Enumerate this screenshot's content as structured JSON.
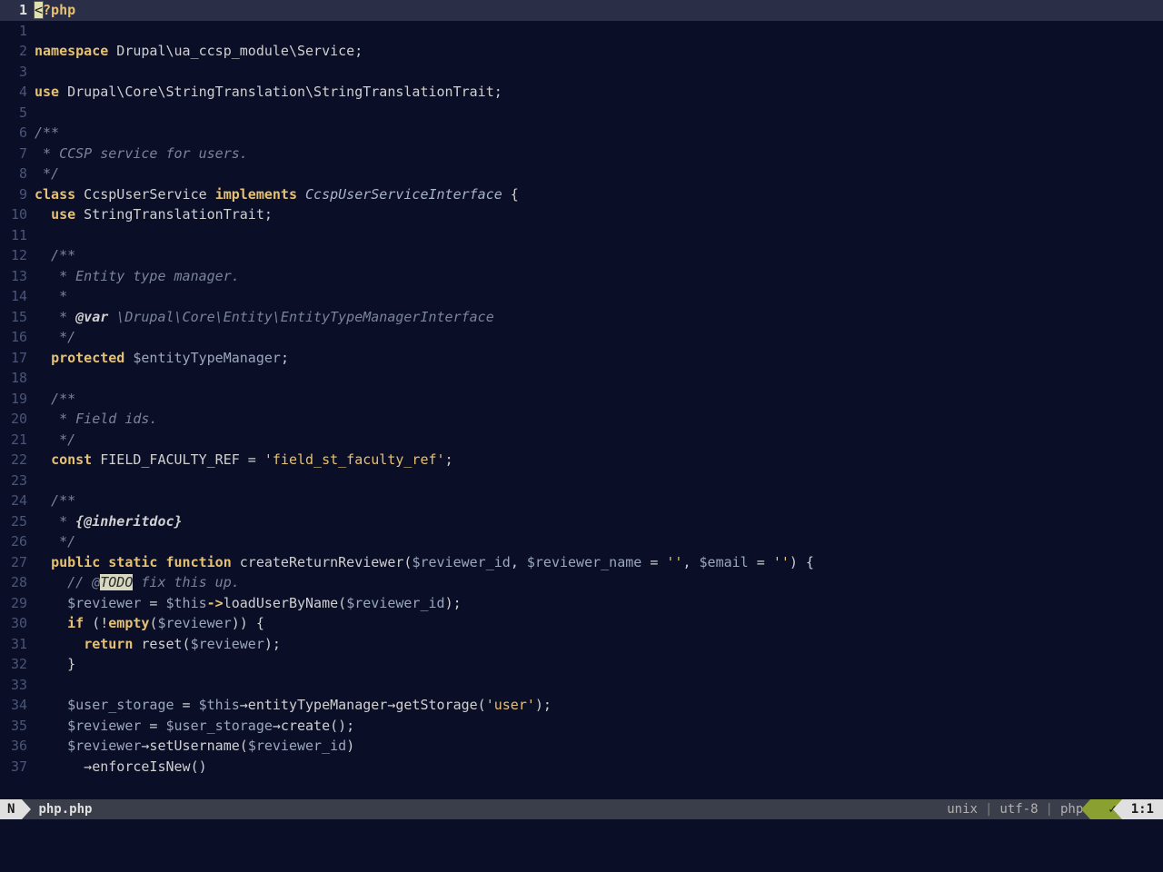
{
  "statusline": {
    "mode": "N",
    "filename": "php.php",
    "fileformat": "unix",
    "encoding": "utf-8",
    "filetype": "php",
    "check": "✓",
    "position": "1:1"
  },
  "cursor": {
    "line": 1,
    "col": 1
  },
  "lines": [
    {
      "n": 1,
      "current": true,
      "tokens": [
        {
          "cls": "cursor",
          "t": "<"
        },
        {
          "cls": "kw",
          "t": "?php"
        }
      ]
    },
    {
      "n": 1,
      "tokens": []
    },
    {
      "n": 2,
      "tokens": [
        {
          "cls": "kw",
          "t": "namespace"
        },
        {
          "cls": "punct",
          "t": " Drupal\\ua_ccsp_module\\Service;"
        }
      ]
    },
    {
      "n": 3,
      "tokens": []
    },
    {
      "n": 4,
      "tokens": [
        {
          "cls": "kw",
          "t": "use"
        },
        {
          "cls": "punct",
          "t": " Drupal\\Core\\StringTranslation\\StringTranslationTrait;"
        }
      ]
    },
    {
      "n": 5,
      "tokens": []
    },
    {
      "n": 6,
      "tokens": [
        {
          "cls": "comment",
          "t": "/**"
        }
      ]
    },
    {
      "n": 7,
      "tokens": [
        {
          "cls": "comment",
          "t": " * CCSP service for users."
        }
      ]
    },
    {
      "n": 8,
      "tokens": [
        {
          "cls": "comment",
          "t": " */"
        }
      ]
    },
    {
      "n": 9,
      "tokens": [
        {
          "cls": "kw",
          "t": "class"
        },
        {
          "cls": "punct",
          "t": " CcspUserService "
        },
        {
          "cls": "kw",
          "t": "implements"
        },
        {
          "cls": "punct",
          "t": " "
        },
        {
          "cls": "type",
          "t": "CcspUserServiceInterface"
        },
        {
          "cls": "punct",
          "t": " {"
        }
      ]
    },
    {
      "n": 10,
      "tokens": [
        {
          "cls": "punct",
          "t": "  "
        },
        {
          "cls": "kw",
          "t": "use"
        },
        {
          "cls": "punct",
          "t": " StringTranslationTrait;"
        }
      ]
    },
    {
      "n": 11,
      "tokens": []
    },
    {
      "n": 12,
      "tokens": [
        {
          "cls": "comment",
          "t": "  /**"
        }
      ]
    },
    {
      "n": 13,
      "tokens": [
        {
          "cls": "comment",
          "t": "   * Entity type manager."
        }
      ]
    },
    {
      "n": 14,
      "tokens": [
        {
          "cls": "comment",
          "t": "   *"
        }
      ]
    },
    {
      "n": 15,
      "tokens": [
        {
          "cls": "comment",
          "t": "   * "
        },
        {
          "cls": "doctag",
          "t": "@var"
        },
        {
          "cls": "comment",
          "t": " \\Drupal\\Core\\Entity\\EntityTypeManagerInterface"
        }
      ]
    },
    {
      "n": 16,
      "tokens": [
        {
          "cls": "comment",
          "t": "   */"
        }
      ]
    },
    {
      "n": 17,
      "tokens": [
        {
          "cls": "punct",
          "t": "  "
        },
        {
          "cls": "kw",
          "t": "protected"
        },
        {
          "cls": "punct",
          "t": " "
        },
        {
          "cls": "var",
          "t": "$entityTypeManager"
        },
        {
          "cls": "punct",
          "t": ";"
        }
      ]
    },
    {
      "n": 18,
      "tokens": []
    },
    {
      "n": 19,
      "tokens": [
        {
          "cls": "comment",
          "t": "  /**"
        }
      ]
    },
    {
      "n": 20,
      "tokens": [
        {
          "cls": "comment",
          "t": "   * Field ids."
        }
      ]
    },
    {
      "n": 21,
      "tokens": [
        {
          "cls": "comment",
          "t": "   */"
        }
      ]
    },
    {
      "n": 22,
      "tokens": [
        {
          "cls": "punct",
          "t": "  "
        },
        {
          "cls": "kw",
          "t": "const"
        },
        {
          "cls": "punct",
          "t": " FIELD_FACULTY_REF = "
        },
        {
          "cls": "str",
          "t": "'field_st_faculty_ref'"
        },
        {
          "cls": "punct",
          "t": ";"
        }
      ]
    },
    {
      "n": 23,
      "tokens": []
    },
    {
      "n": 24,
      "tokens": [
        {
          "cls": "comment",
          "t": "  /**"
        }
      ]
    },
    {
      "n": 25,
      "tokens": [
        {
          "cls": "comment",
          "t": "   * "
        },
        {
          "cls": "doctag",
          "t": "{@inheritdoc}"
        }
      ]
    },
    {
      "n": 26,
      "tokens": [
        {
          "cls": "comment",
          "t": "   */"
        }
      ]
    },
    {
      "n": 27,
      "tokens": [
        {
          "cls": "punct",
          "t": "  "
        },
        {
          "cls": "kw",
          "t": "public"
        },
        {
          "cls": "punct",
          "t": " "
        },
        {
          "cls": "kw",
          "t": "static"
        },
        {
          "cls": "punct",
          "t": " "
        },
        {
          "cls": "kw",
          "t": "function"
        },
        {
          "cls": "punct",
          "t": " createReturnReviewer("
        },
        {
          "cls": "var",
          "t": "$reviewer_id"
        },
        {
          "cls": "punct",
          "t": ", "
        },
        {
          "cls": "var",
          "t": "$reviewer_name"
        },
        {
          "cls": "punct",
          "t": " = "
        },
        {
          "cls": "str",
          "t": "''"
        },
        {
          "cls": "punct",
          "t": ", "
        },
        {
          "cls": "var",
          "t": "$email"
        },
        {
          "cls": "punct",
          "t": " = "
        },
        {
          "cls": "str",
          "t": "''"
        },
        {
          "cls": "punct",
          "t": ") {"
        }
      ]
    },
    {
      "n": 28,
      "tokens": [
        {
          "cls": "comment",
          "t": "    // @"
        },
        {
          "cls": "todo",
          "t": "TODO"
        },
        {
          "cls": "comment",
          "t": " fix this up."
        }
      ]
    },
    {
      "n": 29,
      "tokens": [
        {
          "cls": "punct",
          "t": "    "
        },
        {
          "cls": "var",
          "t": "$reviewer"
        },
        {
          "cls": "punct",
          "t": " = "
        },
        {
          "cls": "var",
          "t": "$this"
        },
        {
          "cls": "kw",
          "t": "->"
        },
        {
          "cls": "punct",
          "t": "loadUserByName("
        },
        {
          "cls": "var",
          "t": "$reviewer_id"
        },
        {
          "cls": "punct",
          "t": ");"
        }
      ]
    },
    {
      "n": 30,
      "tokens": [
        {
          "cls": "punct",
          "t": "    "
        },
        {
          "cls": "kw",
          "t": "if"
        },
        {
          "cls": "punct",
          "t": " (!"
        },
        {
          "cls": "kw",
          "t": "empty"
        },
        {
          "cls": "punct",
          "t": "("
        },
        {
          "cls": "var",
          "t": "$reviewer"
        },
        {
          "cls": "punct",
          "t": ")) {"
        }
      ]
    },
    {
      "n": 31,
      "tokens": [
        {
          "cls": "punct",
          "t": "      "
        },
        {
          "cls": "kw",
          "t": "return"
        },
        {
          "cls": "punct",
          "t": " reset("
        },
        {
          "cls": "var",
          "t": "$reviewer"
        },
        {
          "cls": "punct",
          "t": ");"
        }
      ]
    },
    {
      "n": 32,
      "tokens": [
        {
          "cls": "punct",
          "t": "    }"
        }
      ]
    },
    {
      "n": 33,
      "tokens": []
    },
    {
      "n": 34,
      "tokens": [
        {
          "cls": "punct",
          "t": "    "
        },
        {
          "cls": "var",
          "t": "$user_storage"
        },
        {
          "cls": "punct",
          "t": " = "
        },
        {
          "cls": "var",
          "t": "$this"
        },
        {
          "cls": "punct",
          "t": "→entityTypeManager→getStorage("
        },
        {
          "cls": "str",
          "t": "'user'"
        },
        {
          "cls": "punct",
          "t": ");"
        }
      ]
    },
    {
      "n": 35,
      "tokens": [
        {
          "cls": "punct",
          "t": "    "
        },
        {
          "cls": "var",
          "t": "$reviewer"
        },
        {
          "cls": "punct",
          "t": " = "
        },
        {
          "cls": "var",
          "t": "$user_storage"
        },
        {
          "cls": "punct",
          "t": "→create();"
        }
      ]
    },
    {
      "n": 36,
      "tokens": [
        {
          "cls": "punct",
          "t": "    "
        },
        {
          "cls": "var",
          "t": "$reviewer"
        },
        {
          "cls": "punct",
          "t": "→setUsername("
        },
        {
          "cls": "var",
          "t": "$reviewer_id"
        },
        {
          "cls": "punct",
          "t": ")"
        }
      ]
    },
    {
      "n": 37,
      "tokens": [
        {
          "cls": "punct",
          "t": "      →enforceIsNew()"
        }
      ]
    }
  ]
}
